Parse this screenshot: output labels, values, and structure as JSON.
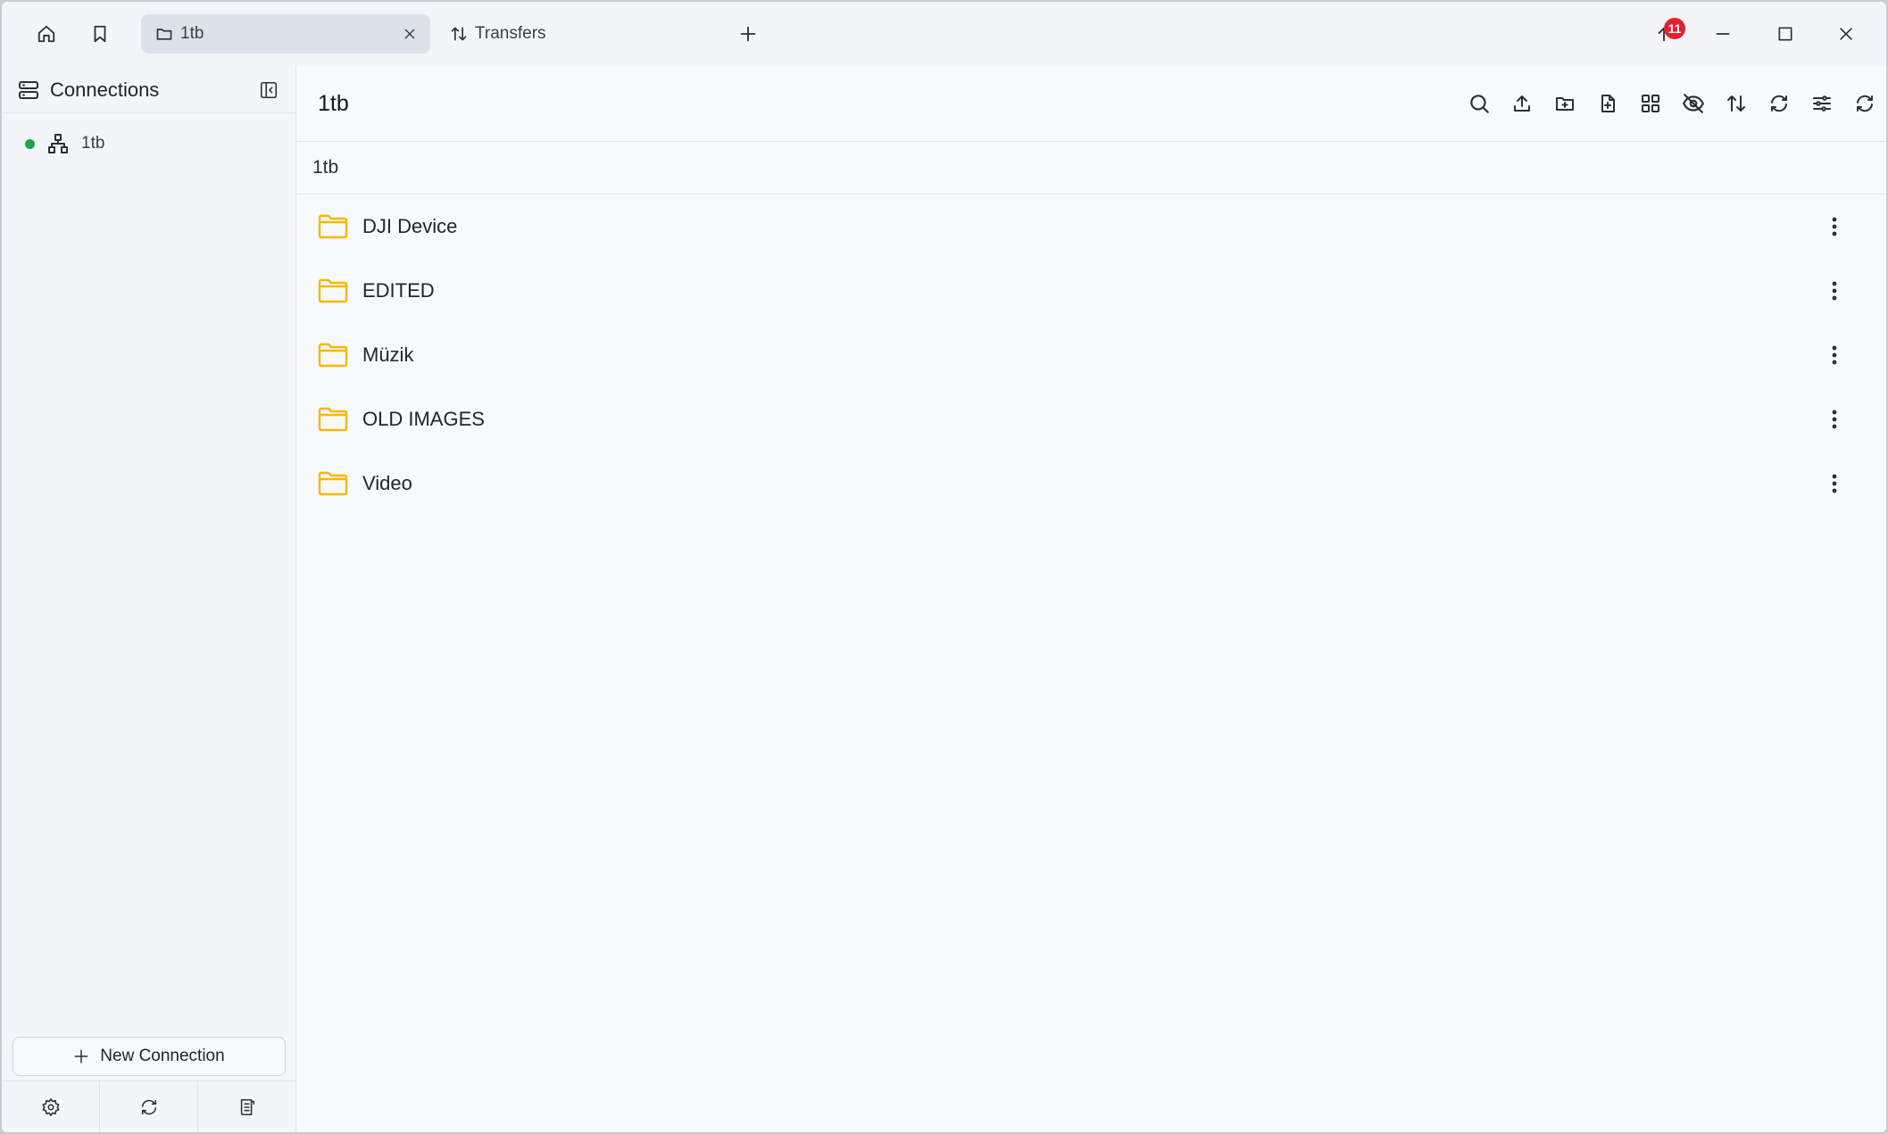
{
  "titlebar": {
    "tabs": [
      {
        "label": "1tb",
        "active": true
      },
      {
        "label": "Transfers",
        "active": false
      }
    ],
    "notification_count": "11"
  },
  "sidebar": {
    "title": "Connections",
    "connections": [
      {
        "label": "1tb",
        "status": "connected",
        "status_color": "#22a447"
      }
    ],
    "new_connection_label": "New Connection"
  },
  "main": {
    "title": "1tb",
    "breadcrumb": "1tb",
    "files": [
      {
        "name": "DJI Device",
        "type": "folder"
      },
      {
        "name": "EDITED",
        "type": "folder"
      },
      {
        "name": "Müzik",
        "type": "folder"
      },
      {
        "name": "OLD IMAGES",
        "type": "folder"
      },
      {
        "name": "Video",
        "type": "folder"
      }
    ]
  },
  "colors": {
    "folder": "#f5b800",
    "badge": "#e5202e",
    "status_connected": "#22a447"
  },
  "icons": {
    "titlebar": [
      "home-icon",
      "bookmark-icon",
      "folder-icon",
      "close-icon",
      "transfer-arrows-icon",
      "plus-icon",
      "upload-progress-icon",
      "minimize-icon",
      "maximize-icon",
      "close-window-icon"
    ],
    "toolbar": [
      "search-icon",
      "upload-icon",
      "new-folder-icon",
      "new-file-icon",
      "grid-view-icon",
      "hidden-files-icon",
      "sort-icon",
      "sync-icon",
      "filter-icon",
      "refresh-icon"
    ],
    "sidebar_footer": [
      "settings-icon",
      "sync-icon",
      "logs-icon"
    ]
  }
}
